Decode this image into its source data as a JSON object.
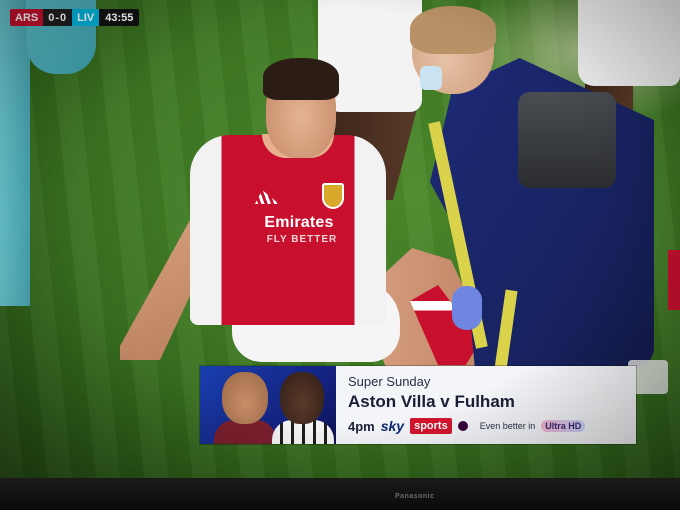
{
  "scoreboard": {
    "home_team": "ARS",
    "home_score": "0",
    "score_separator": "-",
    "away_score": "0",
    "away_team": "LIV",
    "match_clock": "43:55"
  },
  "shirt": {
    "sponsor": "Emirates",
    "sponsor_tagline": "FLY BETTER"
  },
  "advert": {
    "kicker": "Super Sunday",
    "title": "Aston Villa v Fulham",
    "time": "4pm",
    "channel_brand": "sky",
    "channel_name": "sports",
    "tagline": "Even better in",
    "badge": "Ultra HD"
  },
  "tv": {
    "brand": "Panasonic"
  },
  "colors": {
    "arsenal_red": "#c8102e",
    "liverpool_cyan": "#00b2d9",
    "pitch_green": "#3f7a23",
    "physio_blue": "#1d2b77",
    "sky_sports_red": "#d4142d"
  }
}
